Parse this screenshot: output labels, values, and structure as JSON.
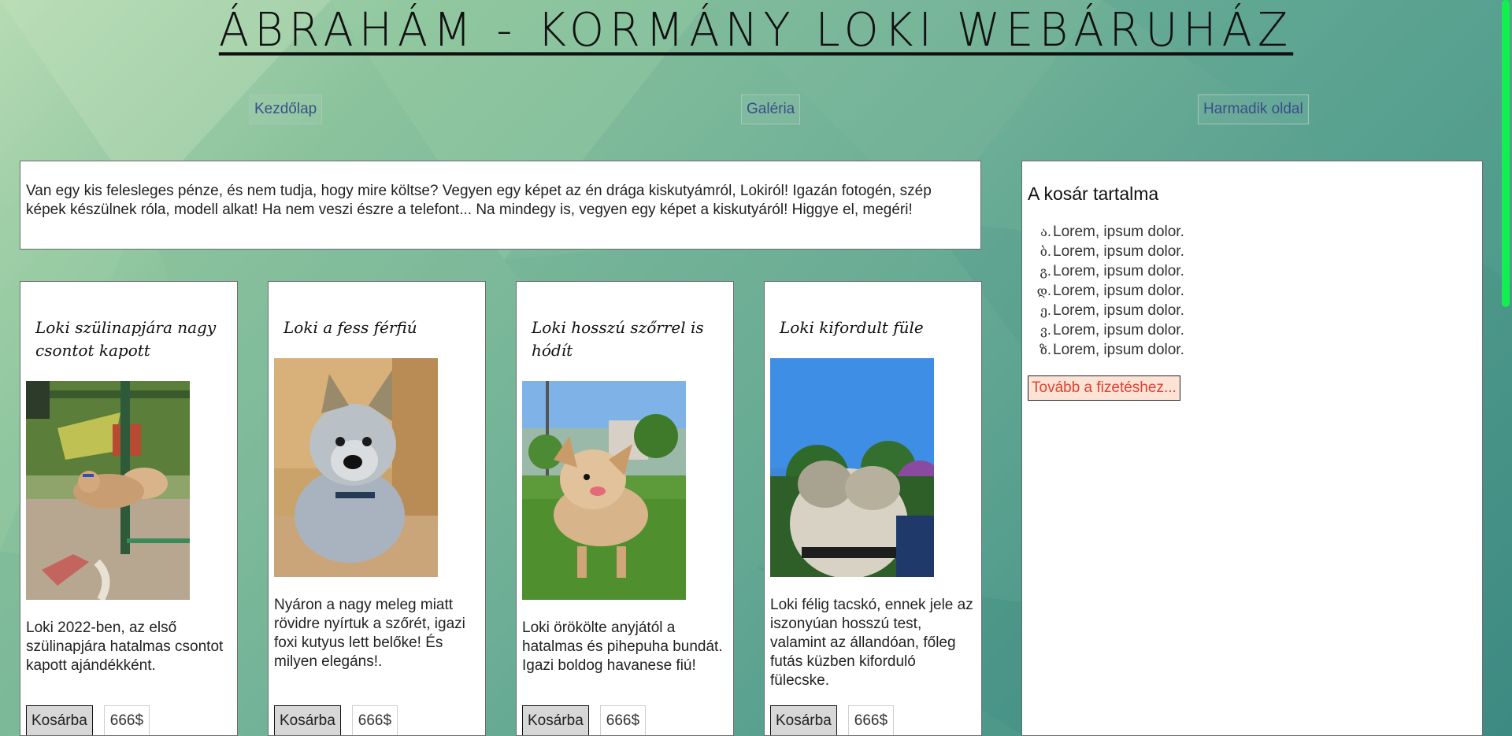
{
  "header": {
    "title": "ÁBRAHÁM - KORMÁNY LOKI WEBÁRUHÁZ"
  },
  "nav": {
    "home": "Kezdőlap",
    "gallery": "Galéria",
    "third": "Harmadik oldal"
  },
  "intro": {
    "text": "Van egy kis felesleges pénze, és nem tudja, hogy mire költse? Vegyen egy képet az én drága kiskutyámról, Lokiról! Igazán fotogén, szép képek készülnek róla, modell alkat! Ha nem veszi észre a telefont... Na mindegy is, vegyen egy képet a kiskutyáról! Higgye el, megéri!"
  },
  "products": [
    {
      "title": "Loki szülinapjára nagy csontot kapott",
      "description": "Loki 2022-ben, az első szülinapjára hatalmas csontot kapott ajándékként.",
      "cart_label": "Kosárba",
      "price": "666$"
    },
    {
      "title": "Loki a fess férfiú",
      "description": "Nyáron a nagy meleg miatt rövidre nyírtuk a szőrét, igazi foxi kutyus lett belőke! És milyen elegáns!.",
      "cart_label": "Kosárba",
      "price": "666$"
    },
    {
      "title": "Loki hosszú szőrrel is hódít",
      "description": "Loki örökölte anyjától a hatalmas és pihepuha bundát. Igazi boldog havanese fiú!",
      "cart_label": "Kosárba",
      "price": "666$"
    },
    {
      "title": "Loki kifordult füle",
      "description": "Loki félig tacskó, ennek jele az iszonyúan hosszú test, valamint az állandóan, főleg futás küzben kiforduló fülecske.",
      "cart_label": "Kosárba",
      "price": "666$"
    }
  ],
  "cart": {
    "title": "A kosár tartalma",
    "items": [
      {
        "marker": "ა.",
        "label": "Lorem, ipsum dolor."
      },
      {
        "marker": "ბ.",
        "label": "Lorem, ipsum dolor."
      },
      {
        "marker": "გ.",
        "label": "Lorem, ipsum dolor."
      },
      {
        "marker": "დ.",
        "label": "Lorem, ipsum dolor."
      },
      {
        "marker": "ე.",
        "label": "Lorem, ipsum dolor."
      },
      {
        "marker": "ვ.",
        "label": "Lorem, ipsum dolor."
      },
      {
        "marker": "ზ.",
        "label": "Lorem, ipsum dolor."
      }
    ],
    "checkout_label": "Tovább a fizetéshez..."
  },
  "colors": {
    "background_start": "#b6dbb3",
    "background_end": "#3d8a82",
    "nav_link": "#3b4d8a",
    "checkout_text": "#e0412f",
    "checkout_bg": "#fde3d6",
    "scrollbar_thumb": "#12f04f"
  }
}
